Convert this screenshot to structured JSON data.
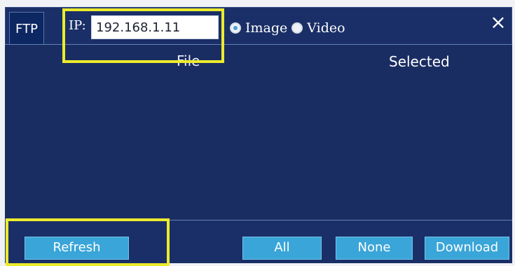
{
  "tabs": [
    {
      "label": "FTP"
    }
  ],
  "toolbar": {
    "ip_label": "IP:",
    "ip_value": "192.168.1.11",
    "radio_image_label": "Image",
    "radio_video_label": "Video",
    "close_icon": "close-icon"
  },
  "list": {
    "columns": [
      "File",
      "Selected"
    ]
  },
  "buttons": {
    "refresh": "Refresh",
    "all": "All",
    "none": "None",
    "download": "Download"
  },
  "colors": {
    "background_dark": "#1a2f67",
    "button_blue": "#39a5d8",
    "highlight_yellow": "#eceb2d"
  }
}
